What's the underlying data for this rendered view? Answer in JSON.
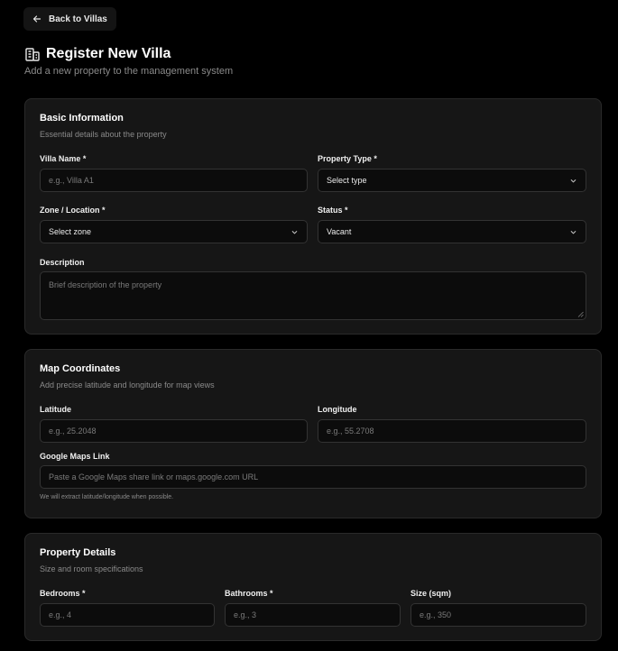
{
  "nav": {
    "back_label": "Back to Villas",
    "back_icon": "arrow-left-icon"
  },
  "header": {
    "icon": "building-icon",
    "title": "Register New Villa",
    "subtitle": "Add a new property to the management system"
  },
  "basic": {
    "title": "Basic Information",
    "description": "Essential details about the property",
    "villa_name": {
      "label": "Villa Name *",
      "placeholder": "e.g., Villa A1",
      "value": ""
    },
    "property_type": {
      "label": "Property Type *",
      "value": "Select type"
    },
    "zone": {
      "label": "Zone / Location *",
      "value": "Select zone"
    },
    "status": {
      "label": "Status *",
      "value": "Vacant"
    },
    "desc_field": {
      "label": "Description",
      "placeholder": "Brief description of the property",
      "value": ""
    }
  },
  "map": {
    "title": "Map Coordinates",
    "description": "Add precise latitude and longitude for map views",
    "latitude": {
      "label": "Latitude",
      "placeholder": "e.g., 25.2048",
      "value": ""
    },
    "longitude": {
      "label": "Longitude",
      "placeholder": "e.g., 55.2708",
      "value": ""
    },
    "maps_link": {
      "label": "Google Maps Link",
      "placeholder": "Paste a Google Maps share link or maps.google.com URL",
      "value": ""
    },
    "hint": "We will extract latitude/longitude when possible."
  },
  "details": {
    "title": "Property Details",
    "description": "Size and room specifications",
    "bedrooms": {
      "label": "Bedrooms *",
      "placeholder": "e.g., 4",
      "value": ""
    },
    "bathrooms": {
      "label": "Bathrooms *",
      "placeholder": "e.g., 3",
      "value": ""
    },
    "size": {
      "label": "Size (sqm)",
      "placeholder": "e.g., 350",
      "value": ""
    }
  },
  "colors": {
    "background": "#000000",
    "card": "#161616",
    "input": "#0c0c0c",
    "border": "#333333",
    "muted_text": "#8a8a8a"
  }
}
